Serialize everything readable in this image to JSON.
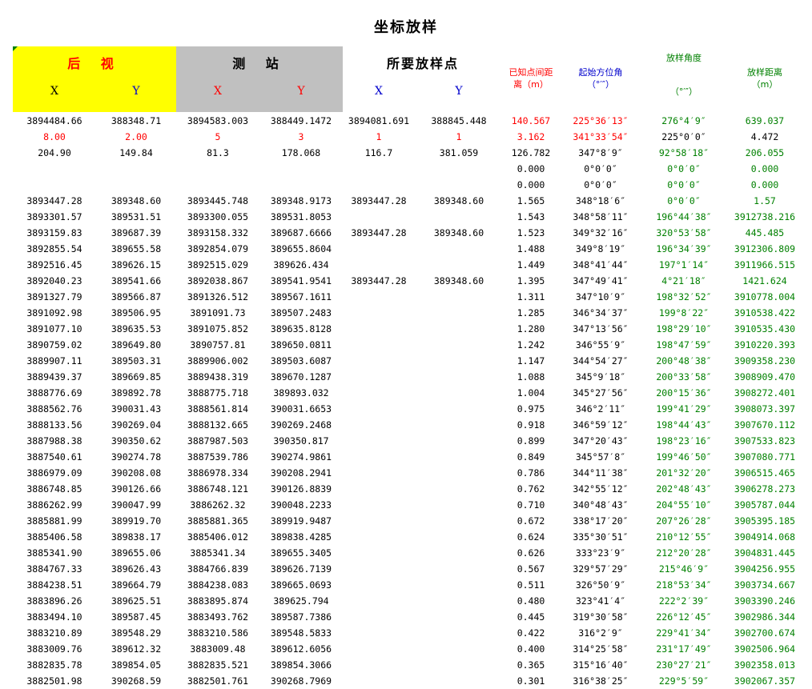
{
  "title": "坐标放样",
  "header": {
    "backsight": "后 视",
    "station": "测 站",
    "stakeout_point": "所要放样点",
    "known_distance": [
      "已知点间距",
      "离（m）"
    ],
    "start_azimuth": [
      "起始方位角",
      "（°′″）"
    ],
    "stakeout_angle": [
      "放样角度",
      "（°′″）"
    ],
    "stakeout_distance": [
      "放样距离",
      "（m）"
    ],
    "x": "X",
    "y": "Y"
  },
  "special_rows": [
    [
      "3894484.66",
      "388348.71",
      "3894583.003",
      "388449.1472",
      "3894081.691",
      "388845.448",
      "140.567",
      "225°36′13″",
      "276°4′9″",
      "639.037"
    ],
    [
      "8.00",
      "2.00",
      "5",
      "3",
      "1",
      "1",
      "3.162",
      "341°33′54″",
      "225°0′0″",
      "4.472"
    ],
    [
      "204.90",
      "149.84",
      "81.3",
      "178.068",
      "116.7",
      "381.059",
      "126.782",
      "347°8′9″",
      "92°58′18″",
      "206.055"
    ],
    [
      "",
      "",
      "",
      "",
      "",
      "",
      "0.000",
      "0°0′0″",
      "0°0′0″",
      "0.000"
    ],
    [
      "",
      "",
      "",
      "",
      "",
      "",
      "0.000",
      "0°0′0″",
      "0°0′0″",
      "0.000"
    ]
  ],
  "rows": [
    [
      "3893447.28",
      "389348.60",
      "3893445.748",
      "389348.9173",
      "3893447.28",
      "389348.60",
      "1.565",
      "348°18′6″",
      "0°0′0″",
      "1.57"
    ],
    [
      "3893301.57",
      "389531.51",
      "3893300.055",
      "389531.8053",
      "",
      "",
      "1.543",
      "348°58′11″",
      "196°44′38″",
      "3912738.216"
    ],
    [
      "3893159.83",
      "389687.39",
      "3893158.332",
      "389687.6666",
      "3893447.28",
      "389348.60",
      "1.523",
      "349°32′16″",
      "320°53′58″",
      "445.485"
    ],
    [
      "3892855.54",
      "389655.58",
      "3892854.079",
      "389655.8604",
      "",
      "",
      "1.488",
      "349°8′19″",
      "196°34′39″",
      "3912306.809"
    ],
    [
      "3892516.45",
      "389626.15",
      "3892515.029",
      "389626.434",
      "",
      "",
      "1.449",
      "348°41′44″",
      "197°1′14″",
      "3911966.515"
    ],
    [
      "3892040.23",
      "389541.66",
      "3892038.867",
      "389541.9541",
      "3893447.28",
      "389348.60",
      "1.395",
      "347°49′41″",
      "4°21′18″",
      "1421.624"
    ],
    [
      "3891327.79",
      "389566.87",
      "3891326.512",
      "389567.1611",
      "",
      "",
      "1.311",
      "347°10′9″",
      "198°32′52″",
      "3910778.004"
    ],
    [
      "3891092.98",
      "389506.95",
      "3891091.73",
      "389507.2483",
      "",
      "",
      "1.285",
      "346°34′37″",
      "199°8′22″",
      "3910538.422"
    ],
    [
      "3891077.10",
      "389635.53",
      "3891075.852",
      "389635.8128",
      "",
      "",
      "1.280",
      "347°13′56″",
      "198°29′10″",
      "3910535.430"
    ],
    [
      "3890759.02",
      "389649.80",
      "3890757.81",
      "389650.0811",
      "",
      "",
      "1.242",
      "346°55′9″",
      "198°47′59″",
      "3910220.393"
    ],
    [
      "3889907.11",
      "389503.31",
      "3889906.002",
      "389503.6087",
      "",
      "",
      "1.147",
      "344°54′27″",
      "200°48′38″",
      "3909358.230"
    ],
    [
      "3889439.37",
      "389669.85",
      "3889438.319",
      "389670.1287",
      "",
      "",
      "1.088",
      "345°9′18″",
      "200°33′58″",
      "3908909.470"
    ],
    [
      "3888776.69",
      "389892.78",
      "3888775.718",
      "389893.032",
      "",
      "",
      "1.004",
      "345°27′56″",
      "200°15′36″",
      "3908272.401"
    ],
    [
      "3888562.76",
      "390031.43",
      "3888561.814",
      "390031.6653",
      "",
      "",
      "0.975",
      "346°2′11″",
      "199°41′29″",
      "3908073.397"
    ],
    [
      "3888133.56",
      "390269.04",
      "3888132.665",
      "390269.2468",
      "",
      "",
      "0.918",
      "346°59′12″",
      "198°44′43″",
      "3907670.112"
    ],
    [
      "3887988.38",
      "390350.62",
      "3887987.503",
      "390350.817",
      "",
      "",
      "0.899",
      "347°20′43″",
      "198°23′16″",
      "3907533.823"
    ],
    [
      "3887540.61",
      "390274.78",
      "3887539.786",
      "390274.9861",
      "",
      "",
      "0.849",
      "345°57′8″",
      "199°46′50″",
      "3907080.771"
    ],
    [
      "3886979.09",
      "390208.08",
      "3886978.334",
      "390208.2941",
      "",
      "",
      "0.786",
      "344°11′38″",
      "201°32′20″",
      "3906515.465"
    ],
    [
      "3886748.85",
      "390126.66",
      "3886748.121",
      "390126.8839",
      "",
      "",
      "0.762",
      "342°55′12″",
      "202°48′43″",
      "3906278.273"
    ],
    [
      "3886262.99",
      "390047.99",
      "3886262.32",
      "390048.2233",
      "",
      "",
      "0.710",
      "340°48′43″",
      "204°55′10″",
      "3905787.044"
    ],
    [
      "3885881.99",
      "389919.70",
      "3885881.365",
      "389919.9487",
      "",
      "",
      "0.672",
      "338°17′20″",
      "207°26′28″",
      "3905395.185"
    ],
    [
      "3885406.58",
      "389838.17",
      "3885406.012",
      "389838.4285",
      "",
      "",
      "0.624",
      "335°30′51″",
      "210°12′55″",
      "3904914.068"
    ],
    [
      "3885341.90",
      "389655.06",
      "3885341.34",
      "389655.3405",
      "",
      "",
      "0.626",
      "333°23′9″",
      "212°20′28″",
      "3904831.445"
    ],
    [
      "3884767.33",
      "389626.43",
      "3884766.839",
      "389626.7139",
      "",
      "",
      "0.567",
      "329°57′29″",
      "215°46′9″",
      "3904256.955"
    ],
    [
      "3884238.51",
      "389664.79",
      "3884238.083",
      "389665.0693",
      "",
      "",
      "0.511",
      "326°50′9″",
      "218°53′34″",
      "3903734.667"
    ],
    [
      "3883896.26",
      "389625.51",
      "3883895.874",
      "389625.794",
      "",
      "",
      "0.480",
      "323°41′4″",
      "222°2′39″",
      "3903390.246"
    ],
    [
      "3883494.10",
      "389587.45",
      "3883493.762",
      "389587.7386",
      "",
      "",
      "0.445",
      "319°30′58″",
      "226°12′45″",
      "3902986.344"
    ],
    [
      "3883210.89",
      "389548.29",
      "3883210.586",
      "389548.5833",
      "",
      "",
      "0.422",
      "316°2′9″",
      "229°41′34″",
      "3902700.674"
    ],
    [
      "3883009.76",
      "389612.32",
      "3883009.48",
      "389612.6056",
      "",
      "",
      "0.400",
      "314°25′58″",
      "231°17′49″",
      "3902506.964"
    ],
    [
      "3882835.78",
      "389854.05",
      "3882835.521",
      "389854.3066",
      "",
      "",
      "0.365",
      "315°16′40″",
      "230°27′21″",
      "3902358.013"
    ],
    [
      "3882501.98",
      "390268.59",
      "3882501.761",
      "390268.7969",
      "",
      "",
      "0.301",
      "316°38′25″",
      "229°5′59″",
      "3902067.357"
    ]
  ],
  "colors": {
    "backsight_fill": "#ffff00",
    "station_fill": "#c0c0c0",
    "red": "#ff0000",
    "blue": "#0000cc",
    "green": "#008000"
  }
}
